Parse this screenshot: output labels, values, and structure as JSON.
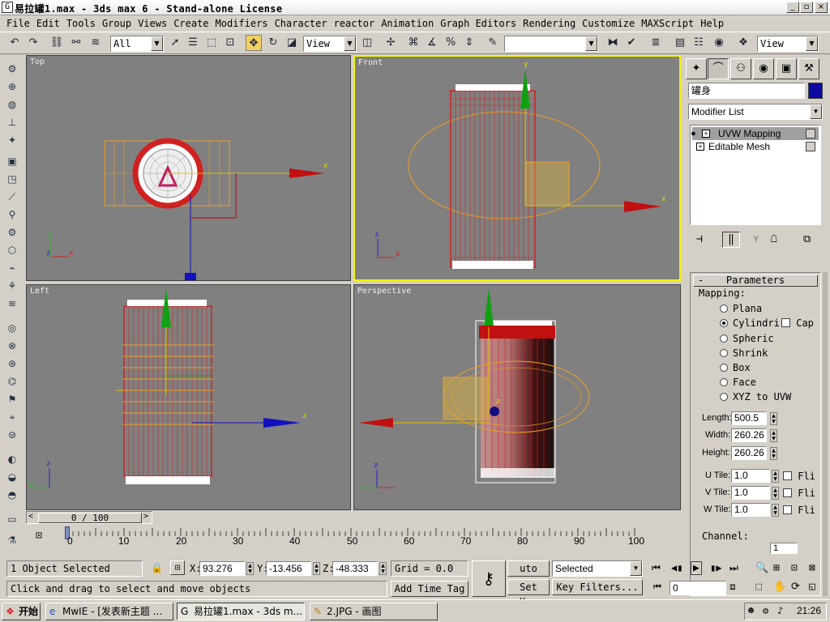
{
  "window": {
    "title": "易拉罐1.max - 3ds max 6 - Stand-alone License",
    "btn_min": "_",
    "btn_max": "▫",
    "btn_close": "×"
  },
  "menu": [
    "File",
    "Edit",
    "Tools",
    "Group",
    "Views",
    "Create",
    "Modifiers",
    "Character",
    "reactor",
    "Animation",
    "Graph Editors",
    "Rendering",
    "Customize",
    "MAXScript",
    "Help"
  ],
  "toolbar": {
    "selection_filter": "All",
    "ref_coord": "View",
    "named_sel": "",
    "view_combo": "View"
  },
  "viewports": {
    "top": "Top",
    "front": "Front",
    "left": "Left",
    "perspective": "Perspective"
  },
  "axes": {
    "x": "x",
    "y": "y",
    "z": "z"
  },
  "command_panel": {
    "object_name": "罐身",
    "object_color": "#0a0aa0",
    "modifier_list": "Modifier List",
    "stack": [
      {
        "label": "UVW Mapping",
        "selected": true,
        "expand": "+"
      },
      {
        "label": "Editable Mesh",
        "selected": false,
        "expand": "+"
      }
    ],
    "rollout_title": "Parameters",
    "rollout_toggle": "-",
    "mapping_label": "Mapping:",
    "mapping_types": [
      {
        "label": "Plana",
        "checked": false
      },
      {
        "label": "Cylindri",
        "checked": true
      },
      {
        "label": "Spheric",
        "checked": false
      },
      {
        "label": "Shrink",
        "checked": false
      },
      {
        "label": "Box",
        "checked": false
      },
      {
        "label": "Face",
        "checked": false
      },
      {
        "label": "XYZ to UVW",
        "checked": false
      }
    ],
    "cap_label": "Cap",
    "length_label": "Length:",
    "length_value": "500.5",
    "width_label": "Width:",
    "width_value": "260.26",
    "height_label": "Height:",
    "height_value": "260.26",
    "utile_label": "U Tile:",
    "utile_value": "1.0",
    "vtile_label": "V Tile:",
    "vtile_value": "1.0",
    "wtile_label": "W Tile:",
    "wtile_value": "1.0",
    "flip_label": "Fli",
    "channel_label": "Channel:",
    "channel_value": "1"
  },
  "timeline": {
    "slider": "0 / 100",
    "ticks": [
      "0",
      "10",
      "20",
      "30",
      "40",
      "50",
      "60",
      "70",
      "80",
      "90",
      "100"
    ]
  },
  "status": {
    "selection": "1 Object Selected",
    "prompt": "Click and drag to select and move objects",
    "x_label": "X:",
    "x_value": "93.276",
    "y_label": "Y:",
    "y_value": "-13.456",
    "z_label": "Z:",
    "z_value": "-48.333",
    "grid": "Grid = 0.0",
    "add_time_tag": "Add Time Tag",
    "auto_key": "uto Key",
    "set_key": "Set Key",
    "key_mode": "Selected",
    "key_filters": "Key Filters...",
    "frame": "0"
  },
  "taskbar": {
    "start": "开始",
    "tasks": [
      "MwIE - [发表新主题 ...",
      "易拉罐1.max - 3ds m...",
      "2.JPG - 画图"
    ],
    "clock": "21:26"
  }
}
